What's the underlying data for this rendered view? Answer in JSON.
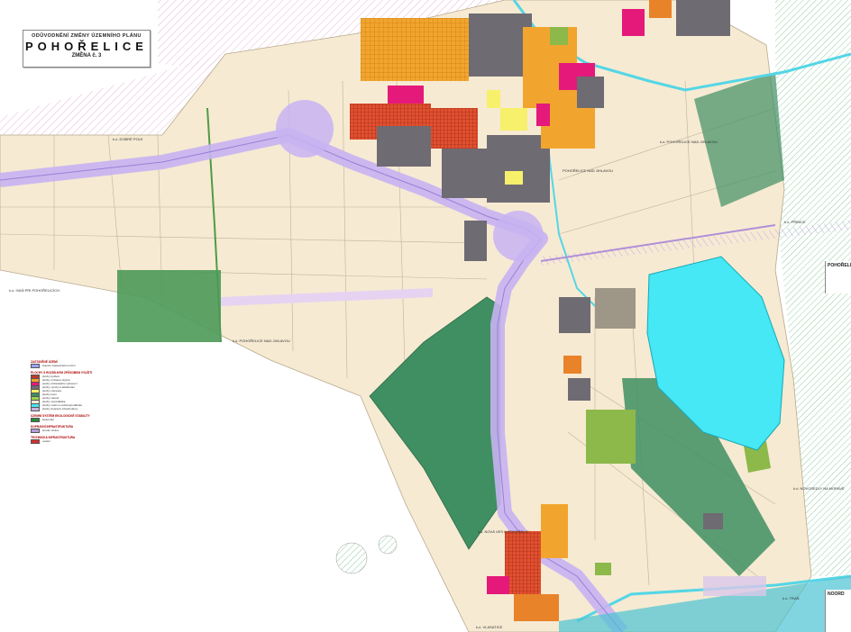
{
  "title": {
    "line1": "ODŮVODNĚNÍ ZMĚNY ÚZEMNÍHO PLÁNU",
    "line2": "POHOŘELICE",
    "line3": "ZMĚNA č. 3"
  },
  "place_labels": [
    {
      "text": "k.ú. DOBRÉ POLE",
      "name": "label-dobre"
    },
    {
      "text": "k.ú. IVAŇ PRI POHOŘELICÍCH",
      "name": "label-ivan"
    },
    {
      "text": "k.ú. POHOŘELICE NAD JIHLAVOU",
      "name": "label-pohorelice-jihlava"
    },
    {
      "text": "POHOŘELICE NAD JIHLAVOU",
      "name": "label-pohorelice-nad"
    },
    {
      "text": "k.ú. POHOŘELICE NAD JIHLAVOU",
      "name": "label-pohorelice-east"
    },
    {
      "text": "k.ú. PŘIBICE",
      "name": "label-pribice"
    },
    {
      "text": "k.ú. NOVÁ VES U POHOŘELIC",
      "name": "label-nova-ves"
    },
    {
      "text": "k.ú. VLASATICE",
      "name": "label-vlasatice"
    },
    {
      "text": "k.ú. TRAŇ",
      "name": "label-tran"
    },
    {
      "text": "k.ú. NOVOSEDLY NA MORAVĚ",
      "name": "label-novosedly"
    }
  ],
  "legend": {
    "sections": [
      {
        "heading": "ZASTAVĚNÉ ÚZEMÍ",
        "rows": [
          {
            "color": "#9aa6ff",
            "text": "hranice zastavěného území"
          }
        ]
      },
      {
        "heading": "PLOCHY S ROZDÍLNÝM ZPŮSOBEM VYUŽITÍ",
        "rows": [
          {
            "color": "#c0392b",
            "text": "plochy bydlení"
          },
          {
            "color": "#f4a12b",
            "text": "plochy smíšené obytné"
          },
          {
            "color": "#e5197a",
            "text": "plochy občanského vybavení"
          },
          {
            "color": "#6e6b72",
            "text": "plochy výroby a skladování"
          },
          {
            "color": "#f7f06a",
            "text": "plochy rekreace"
          },
          {
            "color": "#3f8f62",
            "text": "plochy lesní"
          },
          {
            "color": "#9bd14b",
            "text": "plochy zeleně"
          },
          {
            "color": "#f6ead3",
            "text": "plochy zemědělské"
          },
          {
            "color": "#45e8f4",
            "text": "plochy vodní a vodohospodářské"
          },
          {
            "color": "#c9b3e0",
            "text": "plochy dopravní infrastruktury"
          }
        ]
      },
      {
        "heading": "ÚZEMNÍ SYSTÉM EKOLOGICKÉ STABILITY",
        "rows": [
          {
            "color": "#2c8a3c",
            "text": "biokoridor"
          }
        ]
      },
      {
        "heading": "DOPRAVNÍ INFRASTRUKTURA",
        "rows": [
          {
            "color": "#b39ddb",
            "text": "koridor silnice"
          }
        ]
      },
      {
        "heading": "TECHNICKÁ INFRASTRUKTURA",
        "rows": [
          {
            "color": "#d32f2f",
            "text": "vedení"
          }
        ]
      }
    ]
  },
  "side_panel": {
    "text": "POHOŘELICE"
  },
  "side_panel2": {
    "text": "NOORD"
  },
  "colors": {
    "farmland": "#f6ead3",
    "forest": "#3f8f62",
    "water": "#45e8f4",
    "industry": "#6e6b72",
    "housing": "#e8832a",
    "civic": "#e5197a",
    "road_corridor": "#c8b3f2",
    "green_hatch": "#bfe4c9"
  }
}
